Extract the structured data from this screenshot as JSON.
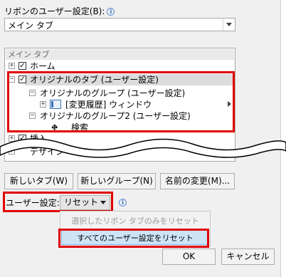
{
  "ribbon_customize": {
    "label": "リボンのユーザー設定(B):",
    "info_icon": "info-icon",
    "selected_value": "メイン タブ"
  },
  "tree": {
    "header": "メイン タブ",
    "items": [
      {
        "label": "ホーム",
        "checked": true,
        "expander": "+"
      },
      {
        "label": "オリジナルのタブ (ユーザー設定)",
        "checked": true,
        "expander": "−"
      },
      {
        "label": "オリジナルのグループ (ユーザー設定)",
        "expander": "−"
      },
      {
        "label": "[変更履歴] ウィンドウ",
        "expander": "+"
      },
      {
        "label": "オリジナルのグループ2 (ユーザー設定)",
        "expander": "−"
      },
      {
        "label": "検索"
      },
      {
        "label": "挿入",
        "checked": true,
        "expander": "+"
      },
      {
        "label": "デザイン",
        "expander": "+"
      }
    ]
  },
  "buttons": {
    "new_tab": "新しいタブ(W)",
    "new_group": "新しいグループ(N)",
    "rename": "名前の変更(M)..."
  },
  "user_settings": {
    "label": "ユーザー設定:",
    "reset_label": "リセット(E)",
    "info_icon": "info-icon"
  },
  "reset_menu": {
    "items": [
      {
        "label": "選択したリボン タブのみをリセット",
        "enabled": false
      },
      {
        "label": "すべてのユーザー設定をリセット",
        "enabled": true
      }
    ]
  },
  "footer": {
    "ok": "OK",
    "cancel": "キャンセル"
  },
  "colors": {
    "highlight_box": "#e00000",
    "selection": "#dcdcdc",
    "menu_hover": "#cde4f7"
  }
}
